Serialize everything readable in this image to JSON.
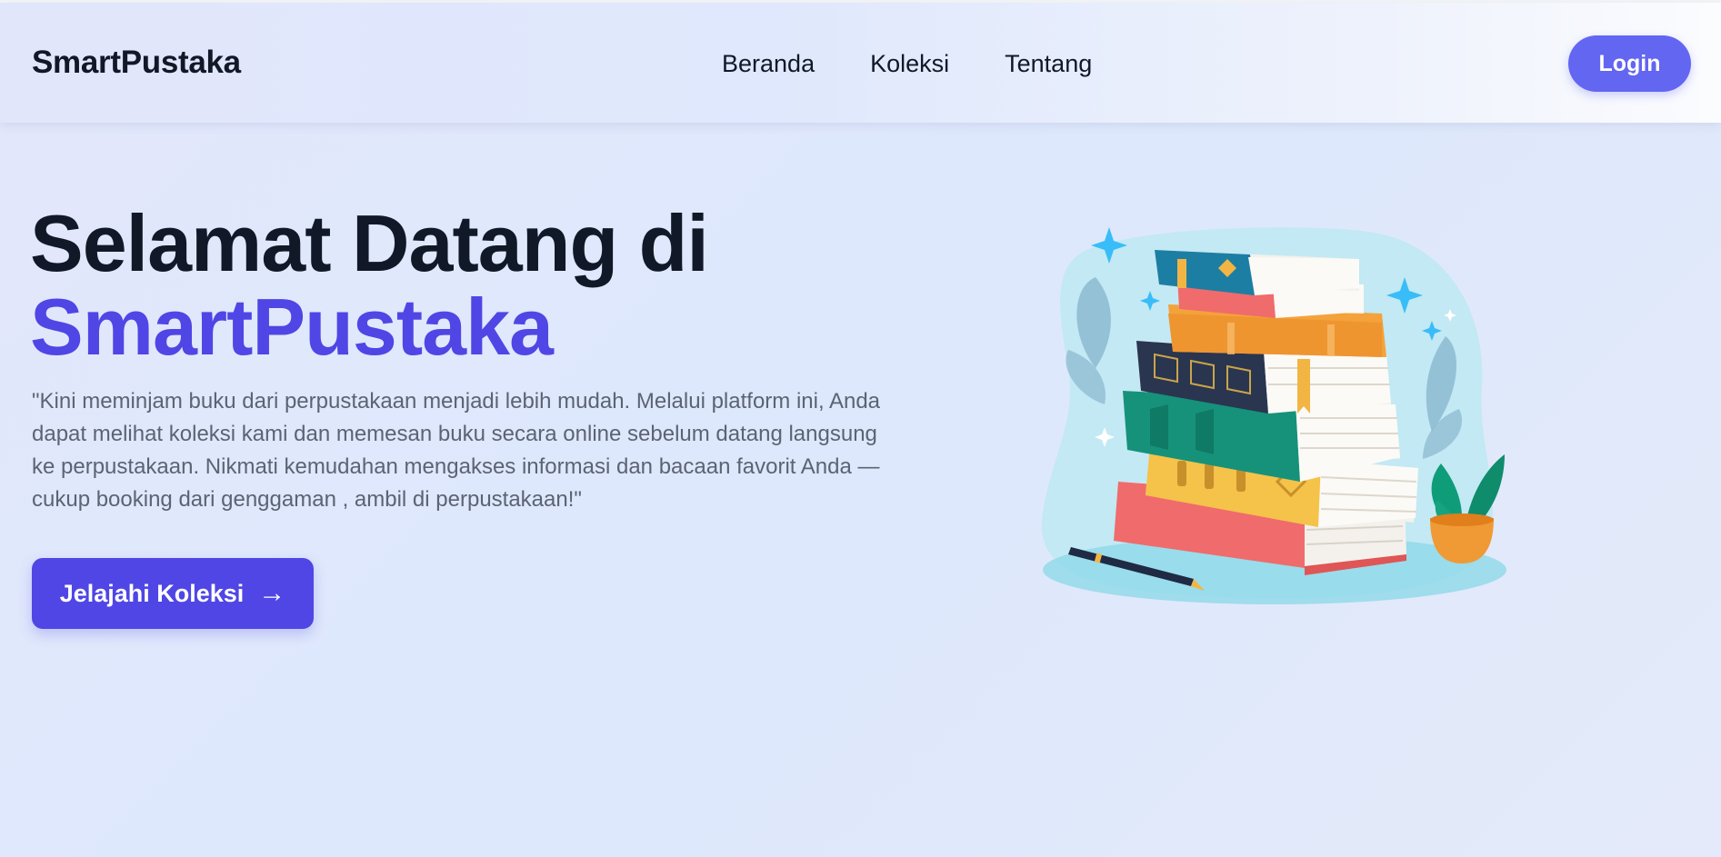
{
  "nav": {
    "brand": "SmartPustaka",
    "links": [
      "Beranda",
      "Koleksi",
      "Tentang"
    ],
    "login_label": "Login",
    "accent_color": "#6366f1"
  },
  "hero": {
    "title_line1": "Selamat Datang di",
    "title_line2": "SmartPustaka",
    "description": "\"Kini meminjam buku dari perpustakaan menjadi lebih mudah. Melalui platform ini, Anda dapat melihat koleksi kami dan memesan buku secara online sebelum datang langsung ke perpustakaan. Nikmati kemudahan mengakses informasi dan bacaan favorit Anda — cukup booking dari genggaman , ambil di perpustakaan!\"",
    "cta_label": "Jelajahi Koleksi",
    "cta_icon": "arrow-right-icon",
    "cta_arrow": "→",
    "brand_color": "#4f46e5"
  },
  "illustration": {
    "icon": "book-stack-illustration"
  }
}
